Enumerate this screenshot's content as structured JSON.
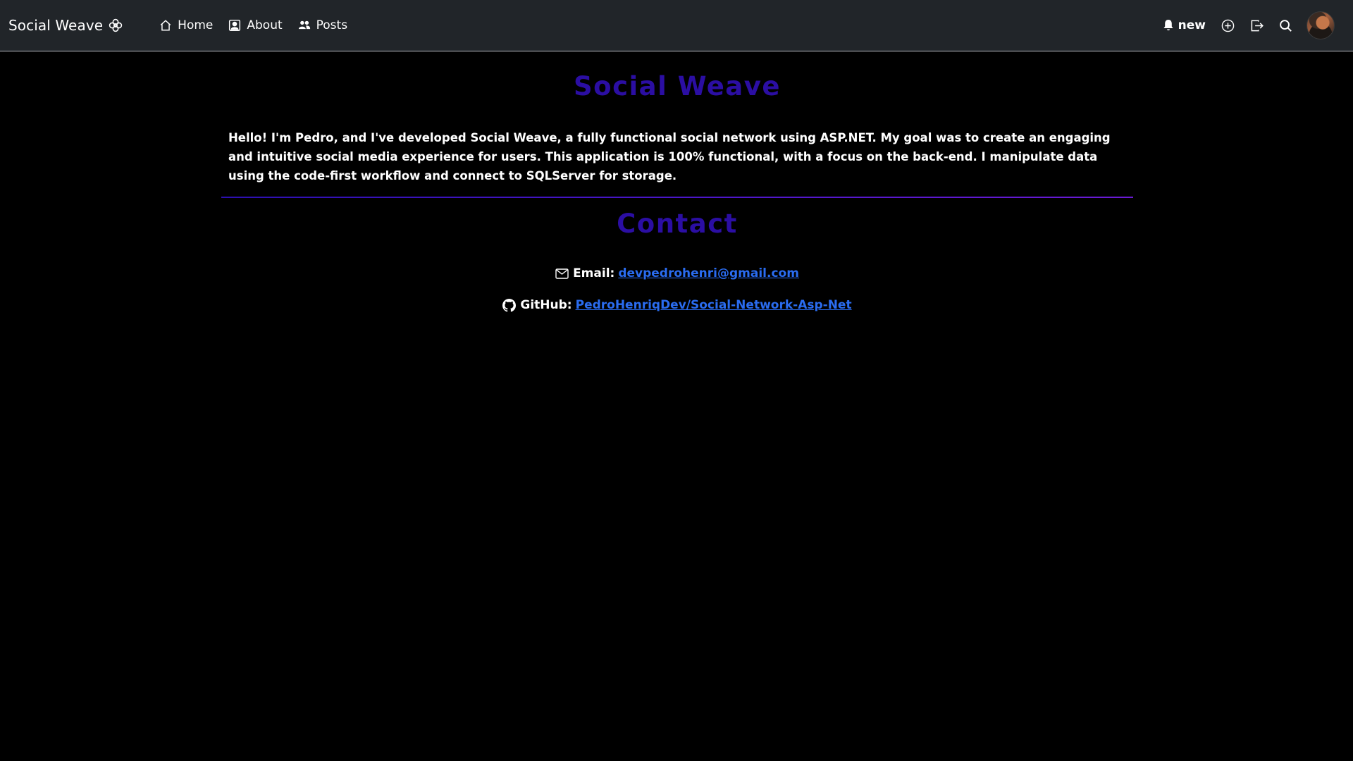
{
  "navbar": {
    "brand": "Social Weave",
    "links": [
      {
        "label": "Home",
        "icon": "house-icon"
      },
      {
        "label": "About",
        "icon": "person-badge-icon"
      },
      {
        "label": "Posts",
        "icon": "people-icon"
      }
    ],
    "notifications_label": "new",
    "icons": [
      "bell-icon",
      "plus-circle-icon",
      "logout-icon",
      "search-icon"
    ]
  },
  "main": {
    "title": "Social Weave",
    "intro": "Hello! I'm Pedro, and I've developed Social Weave, a fully functional social network using ASP.NET. My goal was to create an engaging and intuitive social media experience for users. This application is 100% functional, with a focus on the back-end. I manipulate data using the code-first workflow and connect to SQLServer for storage.",
    "contact_title": "Contact",
    "email_label": "Email:",
    "email_value": "devpedrohenri@gmail.com",
    "github_label": "GitHub:",
    "github_value": "PedroHenriqDev/Social-Network-Asp-Net"
  },
  "colors": {
    "navbar_bg": "#212529",
    "page_bg": "#000000",
    "heading": "#2b0ea3",
    "link": "#2a6cf0"
  }
}
